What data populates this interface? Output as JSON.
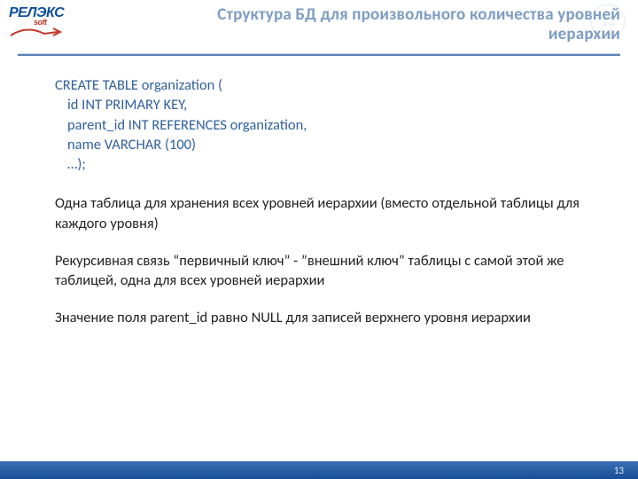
{
  "logo": {
    "main": "РЕЛЭКС",
    "sub": "soft"
  },
  "page_number_badge": "13",
  "title_line1": "Структура БД для произвольного количества уровней",
  "title_line2": "иерархии",
  "sql": {
    "l1": "CREATE TABLE organization (",
    "l2": "id INT PRIMARY KEY,",
    "l3": "parent_id INT REFERENCES organization,",
    "l4": "name VARCHAR (100)",
    "l5": "…);"
  },
  "para1": "Одна таблица для хранения всех уровней иерархии (вместо отдельной таблицы для каждого уровня)",
  "para2": "Рекурсивная связь “первичный ключ” - ”внешний ключ” таблицы с самой этой же таблицей, одна для всех уровней иерархии",
  "para3": "Значение поля parent_id равно NULL для записей верхнего уровня иерархии",
  "footer_page": "13"
}
